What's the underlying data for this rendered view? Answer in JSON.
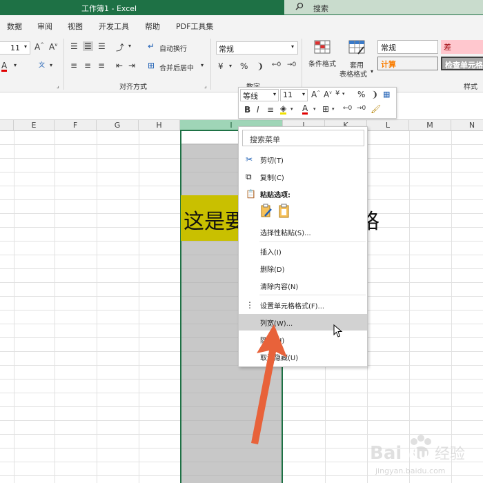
{
  "window": {
    "title": "工作簿1  -  Excel",
    "search_label": "搜索"
  },
  "menu_tabs": [
    "数据",
    "审阅",
    "视图",
    "开发工具",
    "帮助",
    "PDF工具集"
  ],
  "ribbon": {
    "font_size": "11",
    "wrap_text_label": "自动换行",
    "merge_label": "合并后居中",
    "alignment_group": "对齐方式",
    "number_format": "常规",
    "number_group": "数字",
    "conditional_format_label": "条件格式",
    "table_format_label_1": "套用",
    "table_format_label_2": "表格格式",
    "styles_group": "样式",
    "styles": {
      "normal": "常规",
      "bad": "差",
      "calc": "计算",
      "check": "检查单元格"
    }
  },
  "columns": [
    "E",
    "F",
    "G",
    "H",
    "I",
    "J",
    "K",
    "L",
    "M",
    "N"
  ],
  "cell_text": {
    "left": "这是要",
    "right": "格"
  },
  "mini_toolbar": {
    "font": "等线",
    "size": "11"
  },
  "context_menu": {
    "search_placeholder": "搜索菜单",
    "cut": "剪切(T)",
    "copy": "复制(C)",
    "paste_options": "粘贴选项:",
    "paste_special": "选择性粘贴(S)...",
    "insert": "插入(I)",
    "delete": "删除(D)",
    "clear": "清除内容(N)",
    "format_cells": "设置单元格格式(F)...",
    "column_width": "列宽(W)...",
    "hide": "隐藏(H)",
    "unhide": "取消隐藏(U)"
  },
  "watermark": {
    "brand": "Baidu经验",
    "url": "jingyan.baidu.com"
  },
  "colors": {
    "excel_green": "#1e7145",
    "highlight_yellow": "#c9c000",
    "arrow": "#e8623a",
    "bad_style_bg": "#ffc7ce",
    "bad_style_fg": "#9c0006",
    "calc_fg": "#fa7d00"
  }
}
